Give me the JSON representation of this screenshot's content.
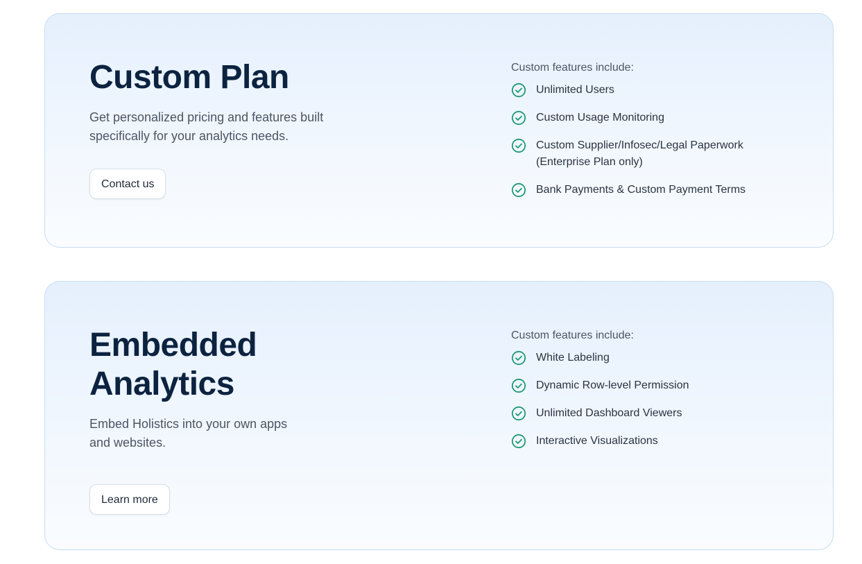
{
  "colors": {
    "title": "#0c2340",
    "check_icon": "#1f9a75",
    "card_border": "#c8dcf0",
    "card_gradient_top": "#e5f0fd",
    "card_gradient_bottom": "#fafcff"
  },
  "cards": [
    {
      "title": "Custom Plan",
      "description": "Get personalized pricing and features built specifically for your analytics needs.",
      "button_label": "Contact us",
      "features_heading": "Custom features include:",
      "features": [
        {
          "icon": "check-circle-icon",
          "label": "Unlimited Users"
        },
        {
          "icon": "check-circle-icon",
          "label": "Custom Usage Monitoring"
        },
        {
          "icon": "check-circle-icon",
          "label": "Custom Supplier/Infosec/Legal Paperwork (Enterprise Plan only)"
        },
        {
          "icon": "check-circle-icon",
          "label": "Bank Payments & Custom Payment Terms"
        }
      ]
    },
    {
      "title": "Embedded\nAnalytics",
      "description": "Embed Holistics into your own apps and websites.",
      "button_label": "Learn more",
      "features_heading": "Custom features include:",
      "features": [
        {
          "icon": "check-circle-icon",
          "label": "White Labeling"
        },
        {
          "icon": "check-circle-icon",
          "label": "Dynamic Row-level Permission"
        },
        {
          "icon": "check-circle-icon",
          "label": "Unlimited Dashboard Viewers"
        },
        {
          "icon": "check-circle-icon",
          "label": "Interactive Visualizations"
        }
      ]
    }
  ]
}
